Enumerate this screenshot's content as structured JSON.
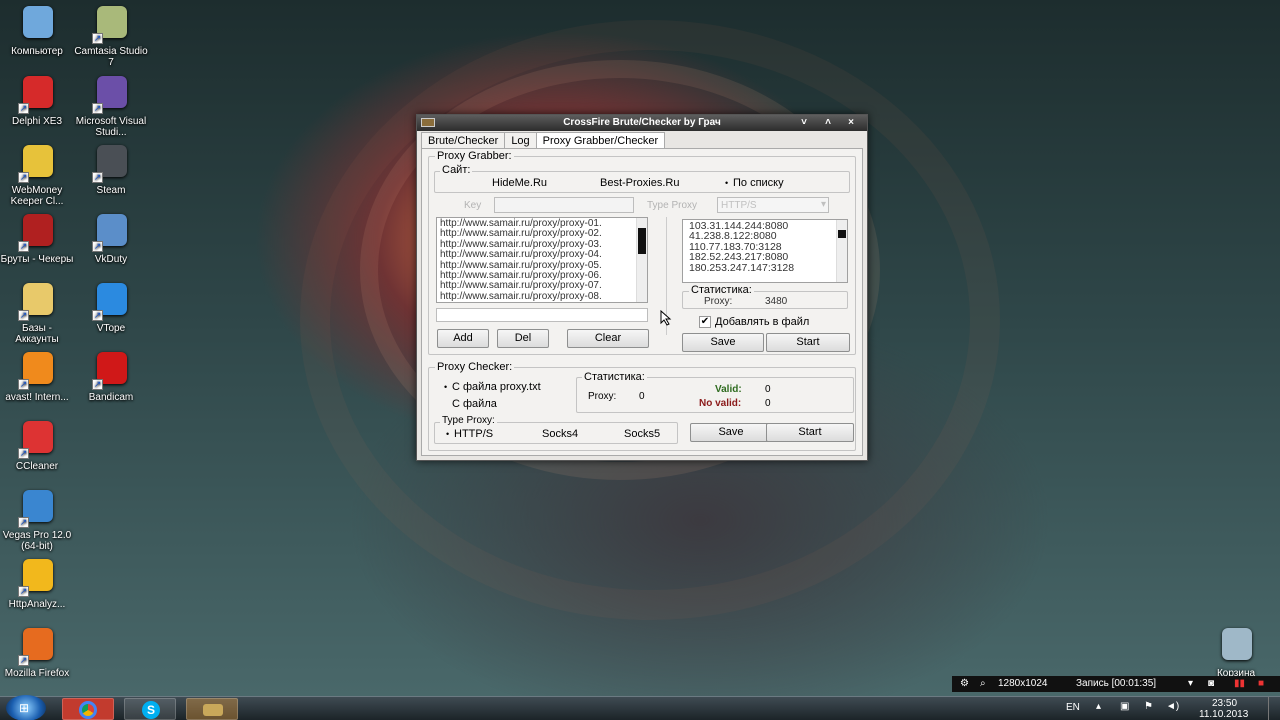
{
  "desktop_icons": [
    {
      "label": "Компьютер",
      "icon": "computer-icon",
      "color": "#6fa8dc"
    },
    {
      "label": "Camtasia Studio 7",
      "icon": "camtasia-icon",
      "color": "#a9b97a"
    },
    {
      "label": "Delphi XE3",
      "icon": "delphi-icon",
      "color": "#d62a2a"
    },
    {
      "label": "Microsoft Visual Studi...",
      "icon": "visual-studio-icon",
      "color": "#6b4fa8"
    },
    {
      "label": "WebMoney Keeper Cl...",
      "icon": "webmoney-icon",
      "color": "#e7c23a"
    },
    {
      "label": "Steam",
      "icon": "steam-icon",
      "color": "#4a4f55"
    },
    {
      "label": "Бруты - Чекеры",
      "icon": "folder-icon",
      "color": "#b02020"
    },
    {
      "label": "VkDuty",
      "icon": "vkduty-icon",
      "color": "#5b8ec9"
    },
    {
      "label": "Базы - Аккаунты",
      "icon": "folder-icon",
      "color": "#e8c96a"
    },
    {
      "label": "VTope",
      "icon": "vtope-icon",
      "color": "#2b8ae0"
    },
    {
      "label": "avast! Intern...",
      "icon": "avast-icon",
      "color": "#f08a1c"
    },
    {
      "label": "Bandicam",
      "icon": "bandicam-icon",
      "color": "#d01818"
    },
    {
      "label": "CCleaner",
      "icon": "ccleaner-icon",
      "color": "#d33"
    },
    {
      "label": "Vegas Pro 12.0 (64-bit)",
      "icon": "vegas-icon",
      "color": "#3a86d0"
    },
    {
      "label": "HttpAnalyz...",
      "icon": "httpanalyzer-icon",
      "color": "#f2b81c"
    },
    {
      "label": "Mozilla Firefox",
      "icon": "firefox-icon",
      "color": "#e66b1f"
    },
    {
      "label": "Корзина",
      "icon": "recycle-bin-icon",
      "color": "#9fb8c8"
    }
  ],
  "window": {
    "title": "CrossFire Brute/Checker by Грач",
    "controls": [
      "˅",
      "˄",
      "×"
    ],
    "tabs": [
      "Brute/Checker",
      "Log",
      "Proxy Grabber/Checker"
    ],
    "grabber": {
      "legend": "Proxy Grabber:",
      "site_legend": "Сайт:",
      "sites": [
        "HideMe.Ru",
        "Best-Proxies.Ru",
        "По списку"
      ],
      "selected_site": 2,
      "key_label": "Key",
      "type_proxy_label": "Type Proxy",
      "type_proxy_value": "HTTP/S",
      "url_list": [
        "http://www.samair.ru/proxy/proxy-01.",
        "http://www.samair.ru/proxy/proxy-02.",
        "http://www.samair.ru/proxy/proxy-03.",
        "http://www.samair.ru/proxy/proxy-04.",
        "http://www.samair.ru/proxy/proxy-05.",
        "http://www.samair.ru/proxy/proxy-06.",
        "http://www.samair.ru/proxy/proxy-07.",
        "http://www.samair.ru/proxy/proxy-08."
      ],
      "proxy_list": [
        "103.31.144.244:8080",
        "41.238.8.122:8080",
        "110.77.183.70:3128",
        "182.52.243.217:8080",
        "180.253.247.147:3128"
      ],
      "add_label": "Add",
      "del_label": "Del",
      "clear_label": "Clear",
      "stats_legend": "Статистика:",
      "proxy_label": "Proxy:",
      "proxy_count": "3480",
      "checkbox_label": "Добавлять в файл",
      "save_label": "Save",
      "start_label": "Start"
    },
    "checker": {
      "legend": "Proxy Checker:",
      "sources": [
        "С файла proxy.txt",
        "С файла"
      ],
      "stats_legend": "Статистика:",
      "proxy_label": "Proxy:",
      "proxy_count": "0",
      "valid_label": "Valid:",
      "valid_count": "0",
      "novalid_label": "No valid:",
      "novalid_count": "0",
      "type_legend": "Type Proxy:",
      "types": [
        "HTTP/S",
        "Socks4",
        "Socks5"
      ],
      "save_label": "Save",
      "start_label": "Start",
      "valid_color": "#2e6b1f",
      "novalid_color": "#8b1a1a"
    }
  },
  "recorder": {
    "resolution": "1280x1024",
    "status": "Запись [00:01:35]"
  },
  "tray": {
    "lang": "EN",
    "time": "23:50",
    "date": "11.10.2013"
  },
  "taskbar": {
    "apps": [
      "chrome-icon",
      "skype-icon",
      "crossfire-app-icon"
    ]
  }
}
